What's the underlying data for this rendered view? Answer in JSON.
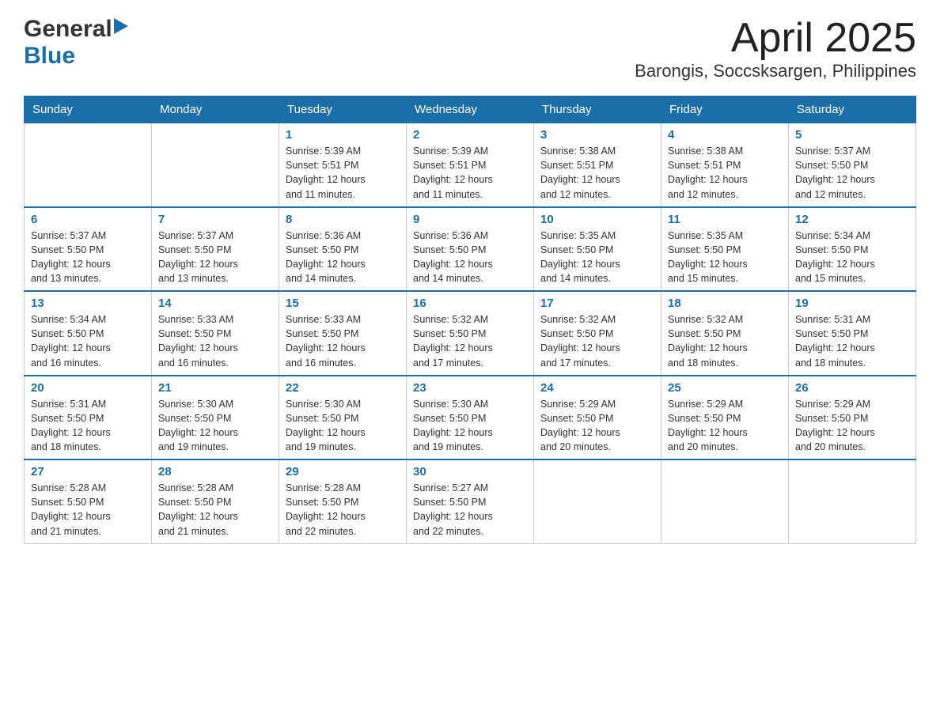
{
  "header": {
    "logo_general": "General",
    "logo_blue": "Blue",
    "title": "April 2025",
    "subtitle": "Barongis, Soccsksargen, Philippines"
  },
  "calendar": {
    "days_of_week": [
      "Sunday",
      "Monday",
      "Tuesday",
      "Wednesday",
      "Thursday",
      "Friday",
      "Saturday"
    ],
    "weeks": [
      [
        {
          "num": "",
          "detail": ""
        },
        {
          "num": "",
          "detail": ""
        },
        {
          "num": "1",
          "detail": "Sunrise: 5:39 AM\nSunset: 5:51 PM\nDaylight: 12 hours\nand 11 minutes."
        },
        {
          "num": "2",
          "detail": "Sunrise: 5:39 AM\nSunset: 5:51 PM\nDaylight: 12 hours\nand 11 minutes."
        },
        {
          "num": "3",
          "detail": "Sunrise: 5:38 AM\nSunset: 5:51 PM\nDaylight: 12 hours\nand 12 minutes."
        },
        {
          "num": "4",
          "detail": "Sunrise: 5:38 AM\nSunset: 5:51 PM\nDaylight: 12 hours\nand 12 minutes."
        },
        {
          "num": "5",
          "detail": "Sunrise: 5:37 AM\nSunset: 5:50 PM\nDaylight: 12 hours\nand 12 minutes."
        }
      ],
      [
        {
          "num": "6",
          "detail": "Sunrise: 5:37 AM\nSunset: 5:50 PM\nDaylight: 12 hours\nand 13 minutes."
        },
        {
          "num": "7",
          "detail": "Sunrise: 5:37 AM\nSunset: 5:50 PM\nDaylight: 12 hours\nand 13 minutes."
        },
        {
          "num": "8",
          "detail": "Sunrise: 5:36 AM\nSunset: 5:50 PM\nDaylight: 12 hours\nand 14 minutes."
        },
        {
          "num": "9",
          "detail": "Sunrise: 5:36 AM\nSunset: 5:50 PM\nDaylight: 12 hours\nand 14 minutes."
        },
        {
          "num": "10",
          "detail": "Sunrise: 5:35 AM\nSunset: 5:50 PM\nDaylight: 12 hours\nand 14 minutes."
        },
        {
          "num": "11",
          "detail": "Sunrise: 5:35 AM\nSunset: 5:50 PM\nDaylight: 12 hours\nand 15 minutes."
        },
        {
          "num": "12",
          "detail": "Sunrise: 5:34 AM\nSunset: 5:50 PM\nDaylight: 12 hours\nand 15 minutes."
        }
      ],
      [
        {
          "num": "13",
          "detail": "Sunrise: 5:34 AM\nSunset: 5:50 PM\nDaylight: 12 hours\nand 16 minutes."
        },
        {
          "num": "14",
          "detail": "Sunrise: 5:33 AM\nSunset: 5:50 PM\nDaylight: 12 hours\nand 16 minutes."
        },
        {
          "num": "15",
          "detail": "Sunrise: 5:33 AM\nSunset: 5:50 PM\nDaylight: 12 hours\nand 16 minutes."
        },
        {
          "num": "16",
          "detail": "Sunrise: 5:32 AM\nSunset: 5:50 PM\nDaylight: 12 hours\nand 17 minutes."
        },
        {
          "num": "17",
          "detail": "Sunrise: 5:32 AM\nSunset: 5:50 PM\nDaylight: 12 hours\nand 17 minutes."
        },
        {
          "num": "18",
          "detail": "Sunrise: 5:32 AM\nSunset: 5:50 PM\nDaylight: 12 hours\nand 18 minutes."
        },
        {
          "num": "19",
          "detail": "Sunrise: 5:31 AM\nSunset: 5:50 PM\nDaylight: 12 hours\nand 18 minutes."
        }
      ],
      [
        {
          "num": "20",
          "detail": "Sunrise: 5:31 AM\nSunset: 5:50 PM\nDaylight: 12 hours\nand 18 minutes."
        },
        {
          "num": "21",
          "detail": "Sunrise: 5:30 AM\nSunset: 5:50 PM\nDaylight: 12 hours\nand 19 minutes."
        },
        {
          "num": "22",
          "detail": "Sunrise: 5:30 AM\nSunset: 5:50 PM\nDaylight: 12 hours\nand 19 minutes."
        },
        {
          "num": "23",
          "detail": "Sunrise: 5:30 AM\nSunset: 5:50 PM\nDaylight: 12 hours\nand 19 minutes."
        },
        {
          "num": "24",
          "detail": "Sunrise: 5:29 AM\nSunset: 5:50 PM\nDaylight: 12 hours\nand 20 minutes."
        },
        {
          "num": "25",
          "detail": "Sunrise: 5:29 AM\nSunset: 5:50 PM\nDaylight: 12 hours\nand 20 minutes."
        },
        {
          "num": "26",
          "detail": "Sunrise: 5:29 AM\nSunset: 5:50 PM\nDaylight: 12 hours\nand 20 minutes."
        }
      ],
      [
        {
          "num": "27",
          "detail": "Sunrise: 5:28 AM\nSunset: 5:50 PM\nDaylight: 12 hours\nand 21 minutes."
        },
        {
          "num": "28",
          "detail": "Sunrise: 5:28 AM\nSunset: 5:50 PM\nDaylight: 12 hours\nand 21 minutes."
        },
        {
          "num": "29",
          "detail": "Sunrise: 5:28 AM\nSunset: 5:50 PM\nDaylight: 12 hours\nand 22 minutes."
        },
        {
          "num": "30",
          "detail": "Sunrise: 5:27 AM\nSunset: 5:50 PM\nDaylight: 12 hours\nand 22 minutes."
        },
        {
          "num": "",
          "detail": ""
        },
        {
          "num": "",
          "detail": ""
        },
        {
          "num": "",
          "detail": ""
        }
      ]
    ]
  }
}
